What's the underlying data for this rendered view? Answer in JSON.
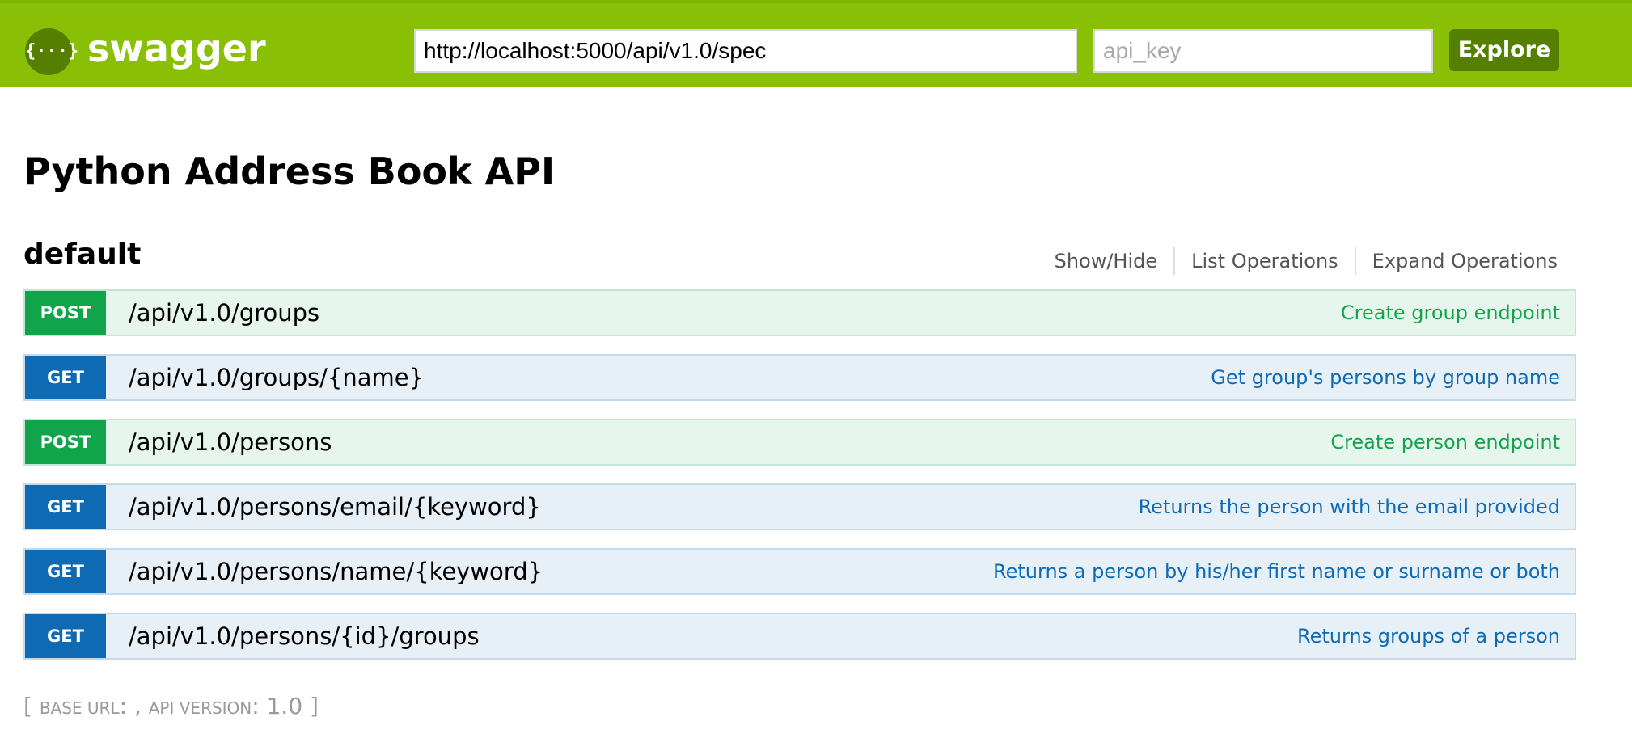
{
  "header": {
    "logo_glyph": "{···}",
    "logo_text": "swagger",
    "spec_url": "http://localhost:5000/api/v1.0/spec",
    "api_key_placeholder": "api_key",
    "explore_label": "Explore"
  },
  "api": {
    "title": "Python Address Book API"
  },
  "resource": {
    "name": "default",
    "links": {
      "show_hide": "Show/Hide",
      "list_operations": "List Operations",
      "expand_operations": "Expand Operations"
    }
  },
  "operations": [
    {
      "method": "POST",
      "path": "/api/v1.0/groups",
      "summary": "Create group endpoint"
    },
    {
      "method": "GET",
      "path": "/api/v1.0/groups/{name}",
      "summary": "Get group's persons by group name"
    },
    {
      "method": "POST",
      "path": "/api/v1.0/persons",
      "summary": "Create person endpoint"
    },
    {
      "method": "GET",
      "path": "/api/v1.0/persons/email/{keyword}",
      "summary": "Returns the person with the email provided"
    },
    {
      "method": "GET",
      "path": "/api/v1.0/persons/name/{keyword}",
      "summary": "Returns a person by his/her first name or surname or both"
    },
    {
      "method": "GET",
      "path": "/api/v1.0/persons/{id}/groups",
      "summary": "Returns groups of a person"
    }
  ],
  "footer": {
    "open_bracket": "[ ",
    "base_url_label": "base url",
    "base_url_value": ": , ",
    "api_version_label": "api version",
    "api_version_value": ": 1.0",
    "close_bracket": " ]"
  },
  "colors": {
    "header_bg": "#89bf04",
    "post_green": "#10a54a",
    "get_blue": "#0f6ab4",
    "explore_bg": "#547f00"
  }
}
